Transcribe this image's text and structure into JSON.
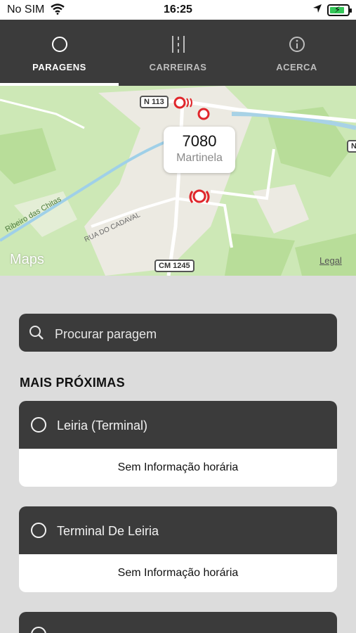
{
  "statusbar": {
    "carrier": "No SIM",
    "time": "16:25"
  },
  "tabs": [
    {
      "label": "PARAGENS",
      "icon": "circle-icon",
      "active": true
    },
    {
      "label": "CARREIRAS",
      "icon": "road-icon",
      "active": false
    },
    {
      "label": "ACERCA",
      "icon": "info-icon",
      "active": false
    }
  ],
  "map": {
    "callout": {
      "code": "7080",
      "name": "Martinela"
    },
    "maps_logo": "Maps",
    "legal": "Legal",
    "road_labels": [
      "N 113",
      "CM 1245",
      "N"
    ],
    "street_labels": [
      "Ribeiro das Chitas",
      "RUA DO CADAVAL"
    ]
  },
  "search": {
    "placeholder": "Procurar paragem"
  },
  "nearest": {
    "title": "MAIS PRÓXIMAS",
    "items": [
      {
        "name": "Leiria (Terminal)",
        "info": "Sem Informação horária"
      },
      {
        "name": "Terminal De Leiria",
        "info": "Sem Informação horária"
      }
    ]
  },
  "colors": {
    "bar": "#3b3b3b",
    "map_green": "#cde8b6",
    "marker_red": "#e0262b",
    "background": "#dcdcdc"
  }
}
